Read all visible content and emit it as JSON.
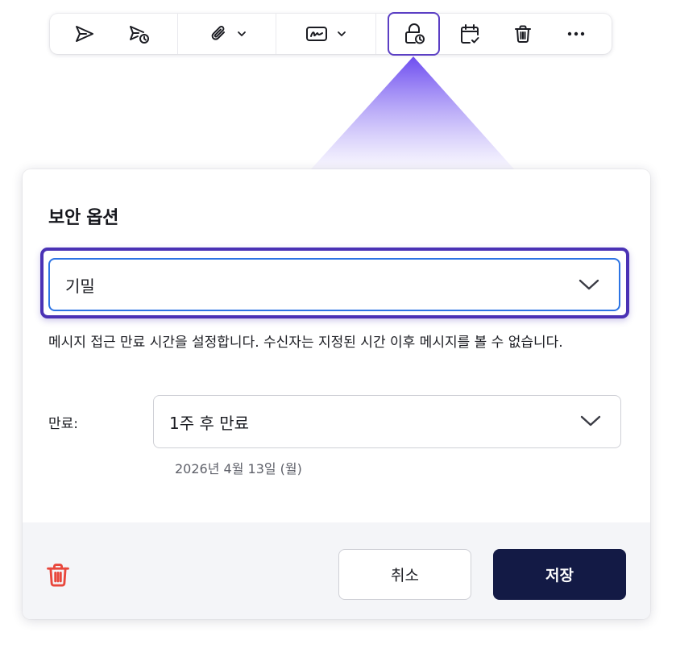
{
  "toolbar": {
    "icons": {
      "send": "send-icon",
      "schedule_send": "schedule-send-icon",
      "attach": "paperclip-icon",
      "signature": "signature-icon",
      "security": "lock-clock-icon",
      "calendar": "calendar-check-icon",
      "delete": "trash-icon",
      "more": "more-horizontal-icon"
    },
    "active_item": "security"
  },
  "dialog": {
    "title": "보안 옵션",
    "level_select": {
      "value": "기밀"
    },
    "help_text": "메시지 접근 만료 시간을 설정합니다. 수신자는 지정된 시간 이후 메시지를 볼 수 없습니다.",
    "expiry": {
      "label": "만료:",
      "value": "1주 후 만료",
      "date_hint": "2026년 4월 13일 (월)"
    },
    "footer": {
      "delete_icon": "trash-icon",
      "cancel_label": "취소",
      "save_label": "저장"
    }
  },
  "colors": {
    "accent": "#4a32b5",
    "focus_blue": "#2c74e4",
    "primary_button": "#131a45",
    "danger": "#e8473c"
  }
}
